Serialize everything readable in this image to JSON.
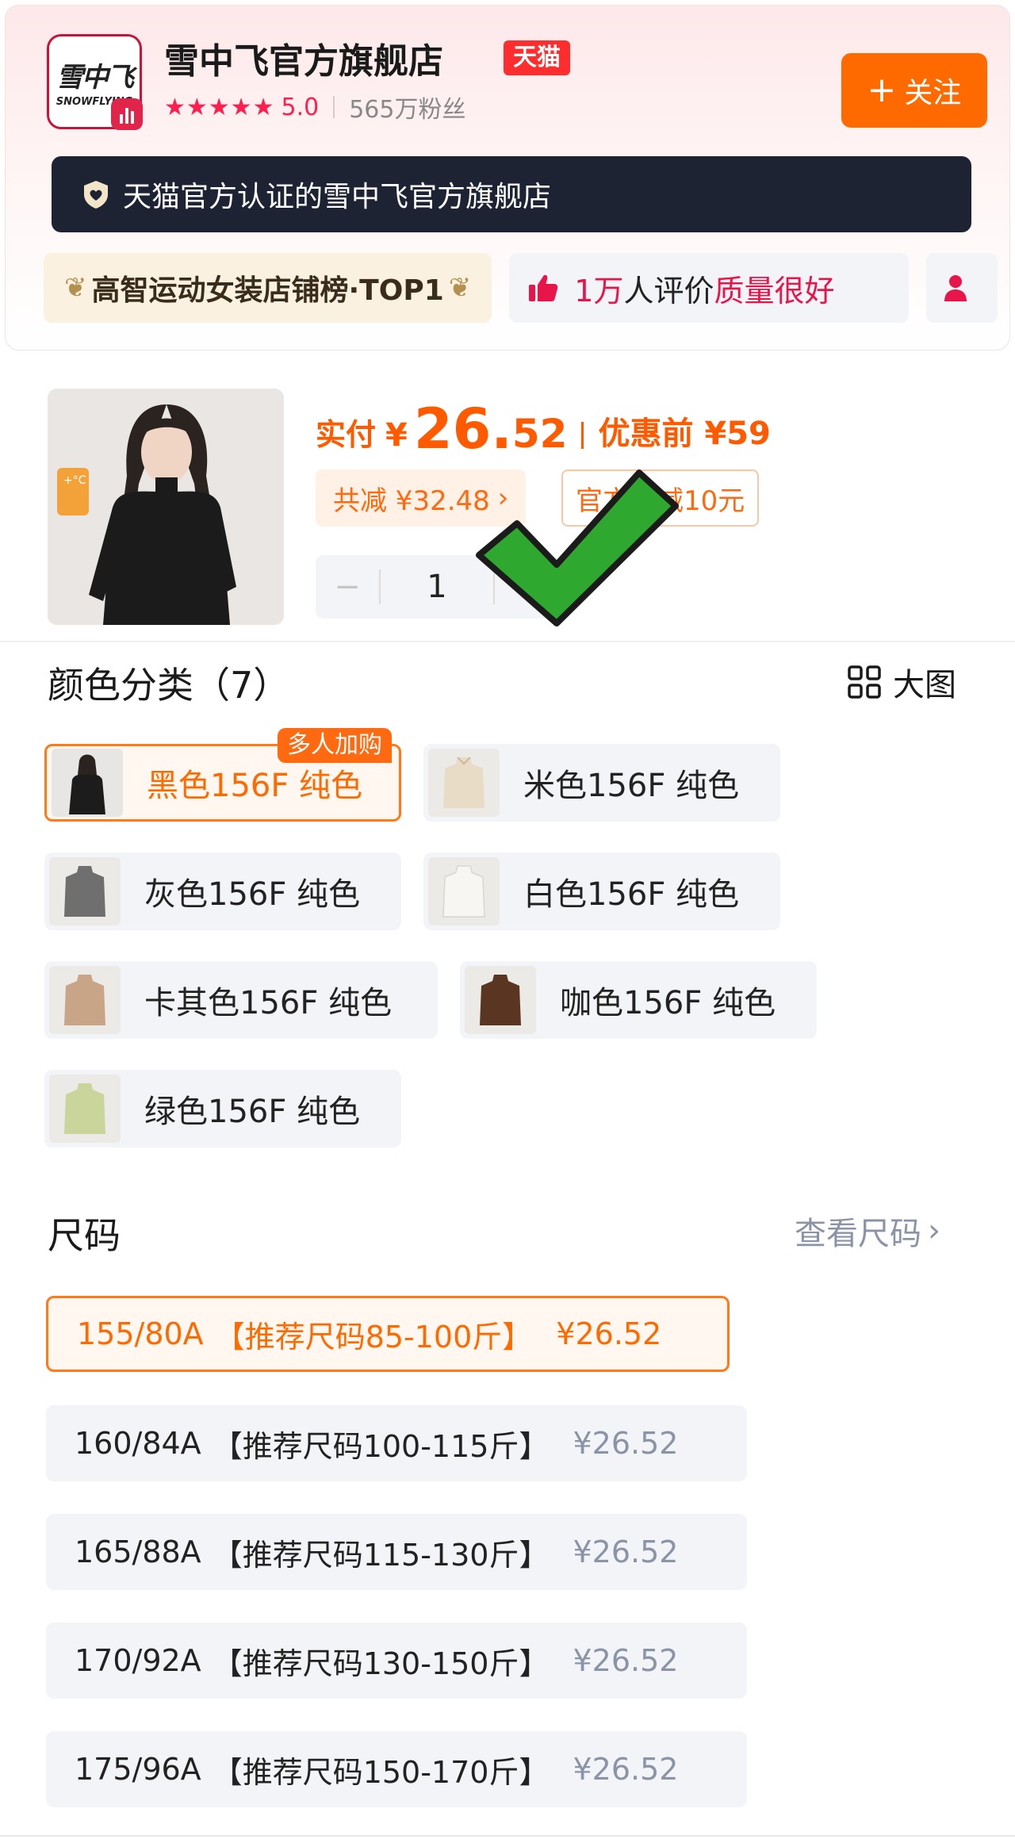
{
  "store": {
    "logo_text": "雪中飞",
    "logo_en": "SNOWFLYING",
    "name": "雪中飞官方旗舰店",
    "platform_tag": "天猫",
    "stars": "★★★★★",
    "rating": "5.0",
    "fans": "565万粉丝",
    "follow_label": "关注",
    "certification": "天猫官方认证的雪中飞官方旗舰店",
    "rank_tag": "高智运动女装店铺榜·TOP1",
    "review_count": "1万",
    "review_mid": "人评价",
    "review_quality": "质量很好"
  },
  "product": {
    "price_label": "实付",
    "currency": "¥",
    "price_int": "26.",
    "price_dec": "52",
    "original_label": "优惠前 ¥59",
    "discount": "共减 ¥32.48",
    "official_promo": "官方立减10元",
    "quantity": "1",
    "qty_minus": "−",
    "qty_plus": "+"
  },
  "colors": {
    "title": "颜色分类（7）",
    "big_view": "大图",
    "hot_badge": "多人加购",
    "options": [
      {
        "label": "黑色156F 纯色",
        "color": "#1c1c1c"
      },
      {
        "label": "米色156F 纯色",
        "color": "#e9dcc6"
      },
      {
        "label": "灰色156F 纯色",
        "color": "#6f6f70"
      },
      {
        "label": "白色156F 纯色",
        "color": "#f3f1ee"
      },
      {
        "label": "卡其色156F 纯色",
        "color": "#c9a588"
      },
      {
        "label": "咖色156F 纯色",
        "color": "#5a3522"
      },
      {
        "label": "绿色156F 纯色",
        "color": "#c9d59a"
      }
    ]
  },
  "sizes": {
    "title": "尺码",
    "guide": "查看尺码",
    "options": [
      {
        "size": "155/80A",
        "rec": "【推荐尺码85-100斤】",
        "price": "¥26.52"
      },
      {
        "size": "160/84A",
        "rec": "【推荐尺码100-115斤】",
        "price": "¥26.52"
      },
      {
        "size": "165/88A",
        "rec": "【推荐尺码115-130斤】",
        "price": "¥26.52"
      },
      {
        "size": "170/92A",
        "rec": "【推荐尺码130-150斤】",
        "price": "¥26.52"
      },
      {
        "size": "175/96A",
        "rec": "【推荐尺码150-170斤】",
        "price": "¥26.52"
      }
    ]
  },
  "theme": {
    "accent": "#ff6a00",
    "tmall_red": "#ff2d2d",
    "cert_bg": "#1d2333",
    "check_green": "#2ea82e"
  }
}
